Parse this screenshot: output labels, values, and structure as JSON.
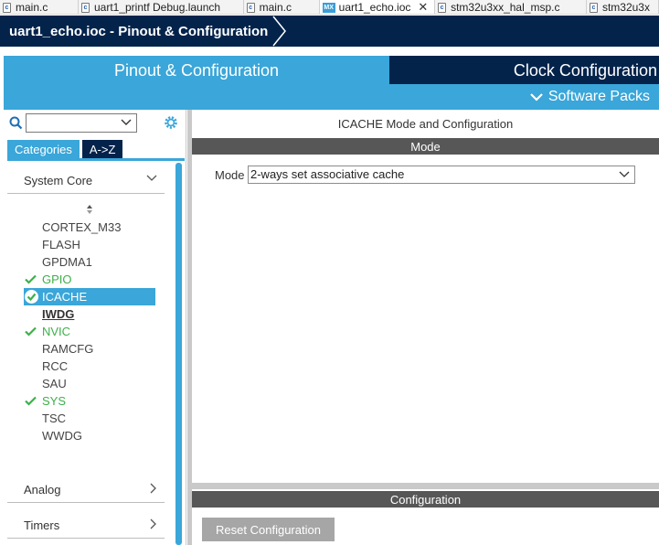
{
  "editor_tabs": [
    {
      "label": "main.c",
      "icon": "c-file-icon",
      "active": false
    },
    {
      "label": "uart1_printf Debug.launch",
      "icon": "c-file-icon",
      "active": false
    },
    {
      "label": "main.c",
      "icon": "c-file-icon",
      "active": false
    },
    {
      "label": "uart1_echo.ioc",
      "icon": "mx-file-icon",
      "icon_text": "MX",
      "active": true,
      "closable": true
    },
    {
      "label": "stm32u3xx_hal_msp.c",
      "icon": "c-file-icon",
      "active": false
    },
    {
      "label": "stm32u3x",
      "icon": "c-file-icon",
      "active": false
    }
  ],
  "breadcrumb": {
    "label": "uart1_echo.ioc - Pinout & Configuration"
  },
  "header": {
    "pinout_tab": "Pinout & Configuration",
    "clock_tab": "Clock Configuration",
    "software_packs": "Software Packs"
  },
  "left_panel": {
    "search": {
      "value": "",
      "placeholder": ""
    },
    "tabs": {
      "categories": "Categories",
      "az": "A->Z"
    },
    "sections": {
      "system_core": "System Core",
      "analog": "Analog",
      "timers": "Timers"
    },
    "items": [
      {
        "label": "CORTEX_M33",
        "status": "none"
      },
      {
        "label": "FLASH",
        "status": "none"
      },
      {
        "label": "GPDMA1",
        "status": "none"
      },
      {
        "label": "GPIO",
        "status": "ok"
      },
      {
        "label": "ICACHE",
        "status": "selected"
      },
      {
        "label": "IWDG",
        "status": "bold"
      },
      {
        "label": "NVIC",
        "status": "ok"
      },
      {
        "label": "RAMCFG",
        "status": "none"
      },
      {
        "label": "RCC",
        "status": "none"
      },
      {
        "label": "SAU",
        "status": "none"
      },
      {
        "label": "SYS",
        "status": "ok"
      },
      {
        "label": "TSC",
        "status": "none"
      },
      {
        "label": "WWDG",
        "status": "none"
      }
    ]
  },
  "right_panel": {
    "title": "ICACHE Mode and Configuration",
    "mode_header": "Mode",
    "mode_label": "Mode",
    "mode_value": "2-ways set associative cache",
    "config_header": "Configuration",
    "reset_button": "Reset Configuration"
  },
  "colors": {
    "navy": "#03234b",
    "accent": "#3aa6d9",
    "ok_green": "#3cb049",
    "bar_gray": "#575757",
    "button_gray": "#a6a6a6"
  }
}
